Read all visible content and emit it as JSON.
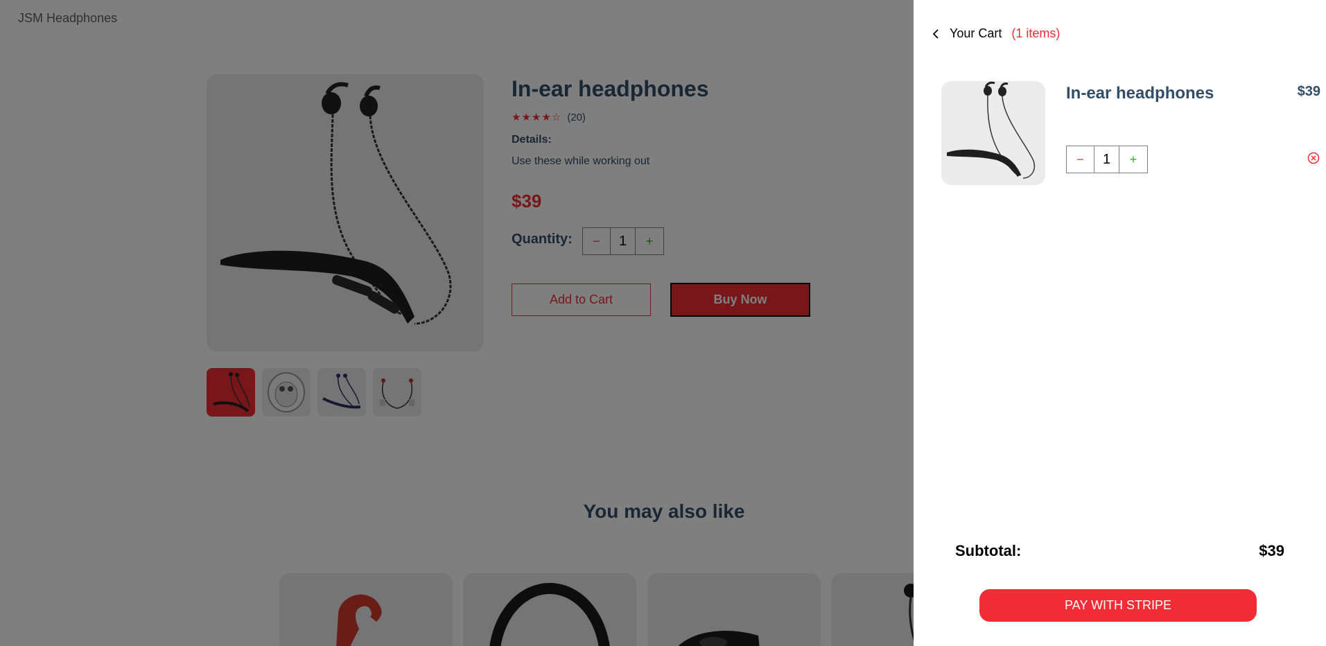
{
  "brand": {
    "logo": "JSM Headphones"
  },
  "product": {
    "title": "In-ear headphones",
    "rating_count": "(20)",
    "stars": "★★★★☆",
    "details_label": "Details:",
    "details_text": "Use these while working out",
    "price": "$39",
    "quantity_label": "Quantity:",
    "quantity": "1",
    "minus": "−",
    "plus": "+",
    "add_to_cart": "Add to Cart",
    "buy_now": "Buy Now"
  },
  "recommendations": {
    "title": "You may also like"
  },
  "cart": {
    "title": "Your Cart",
    "count": "(1 items)",
    "item": {
      "name": "In-ear headphones",
      "price": "$39",
      "quantity": "1"
    },
    "minus": "−",
    "plus": "+",
    "subtotal_label": "Subtotal:",
    "subtotal_value": "$39",
    "pay_button": "PAY WITH STRIPE"
  },
  "colors": {
    "accent": "#f02d34",
    "text": "#324d67",
    "green": "#31a831",
    "image_bg": "#ebebeb"
  }
}
